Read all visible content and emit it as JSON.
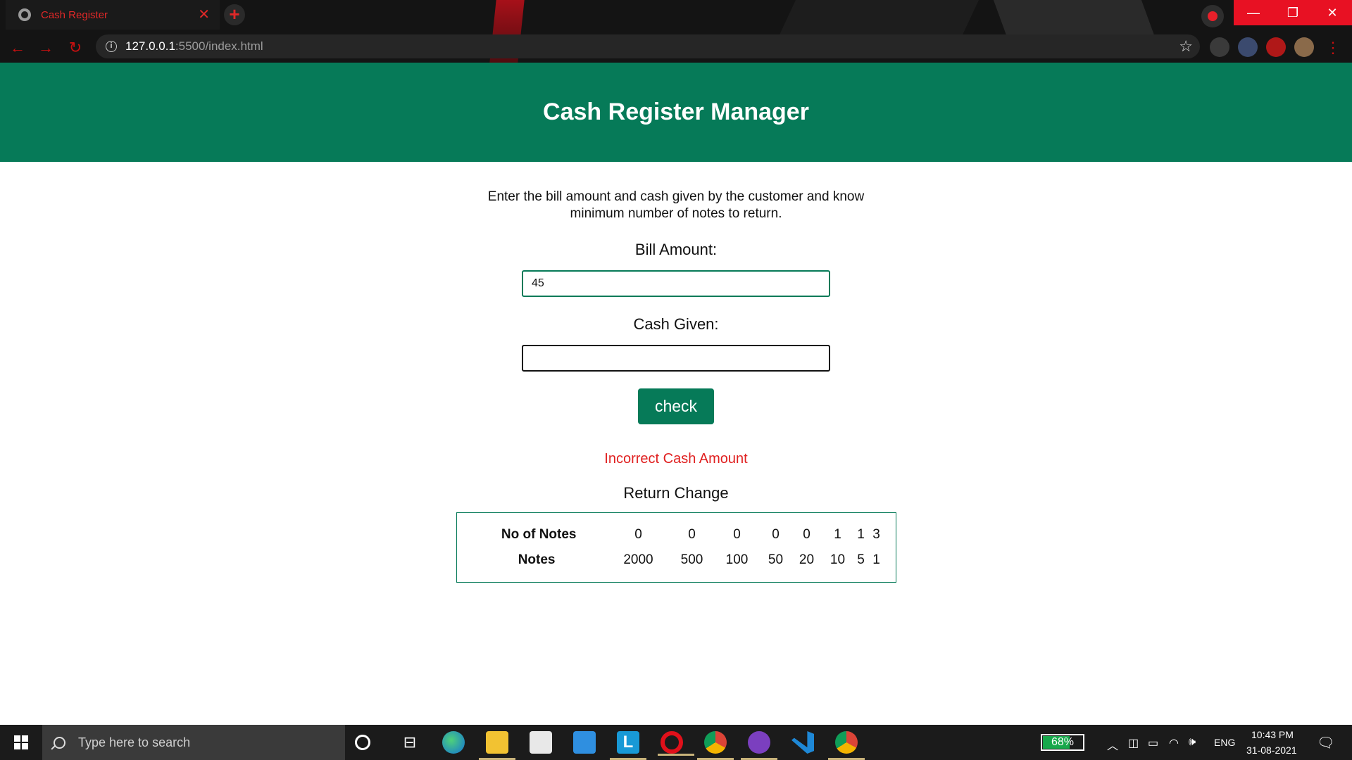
{
  "browser": {
    "tab_title": "Cash Register",
    "tab_close": "✕",
    "new_tab": "+",
    "url_host": "127.0.0.1",
    "url_path": ":5500/index.html",
    "window_buttons": {
      "minimize": "—",
      "restore": "❐",
      "close": "✕"
    }
  },
  "page": {
    "title": "Cash Register Manager",
    "description": "Enter the bill amount and cash given by the customer and know minimum number of notes to return.",
    "bill_label": "Bill Amount:",
    "bill_value": "45",
    "cash_label": "Cash Given:",
    "cash_value": "",
    "check_button": "check",
    "error_message": "Incorrect Cash Amount",
    "return_title": "Return Change",
    "table": {
      "count_label": "No of Notes",
      "notes_label": "Notes",
      "counts": [
        "0",
        "0",
        "0",
        "0",
        "0",
        "1",
        "1",
        "3"
      ],
      "notes": [
        "2000",
        "500",
        "100",
        "50",
        "20",
        "10",
        "5",
        "1"
      ]
    }
  },
  "taskbar": {
    "search_placeholder": "Type here to search",
    "battery_percent": 68,
    "battery_label": "68%",
    "language": "ENG",
    "time": "10:43 PM",
    "date": "31-08-2021",
    "apps": [
      "cortana-icon",
      "task-view-icon",
      "edge-icon",
      "file-explorer-icon",
      "store-icon",
      "mail-icon",
      "l-app-icon",
      "opera-icon",
      "chrome-icon",
      "github-desktop-icon",
      "vscode-icon",
      "chrome-icon"
    ]
  },
  "colors": {
    "brand_green": "#067a58",
    "error_red": "#e02020",
    "browser_accent": "#e02828"
  }
}
